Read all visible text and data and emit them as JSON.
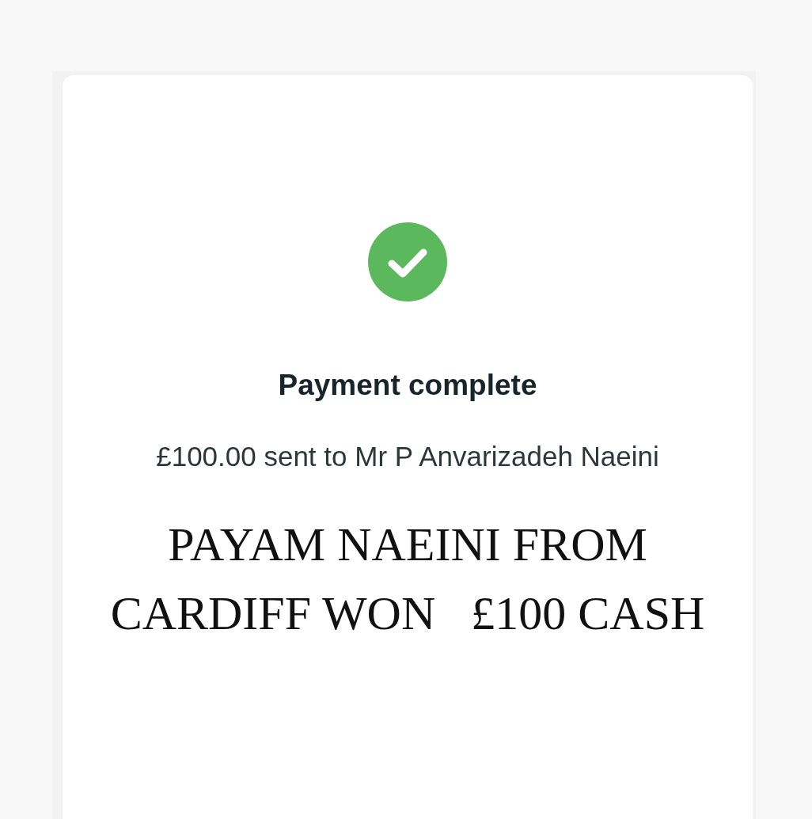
{
  "title": "Payment complete",
  "detail": "£100.00 sent to Mr P Anvarizadeh Naeini",
  "caption": {
    "lines": [
      "PAYAM NAEINI FROM",
      "CARDIFF WON   £100 CASH"
    ]
  }
}
